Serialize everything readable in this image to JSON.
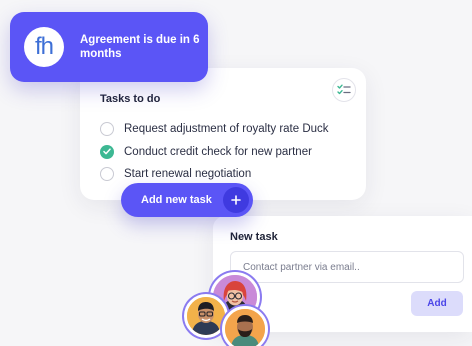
{
  "notification": {
    "logo_text": "fh",
    "message": "Agreement is due in 6 months",
    "color": "#5b55f6"
  },
  "tasks": {
    "title": "Tasks to do",
    "header_icon": "checklist-icon",
    "items": [
      {
        "label": "Request adjustment of royalty rate Duck",
        "done": false
      },
      {
        "label": "Conduct credit check for new partner",
        "done": true
      },
      {
        "label": "Start renewal negotiation",
        "done": false
      }
    ],
    "done_color": "#3db893"
  },
  "add_task_button": {
    "label": "Add new task",
    "icon": "plus-icon"
  },
  "new_task": {
    "title": "New task",
    "input_placeholder": "Contact partner via email..",
    "input_value": "",
    "add_label": "Add"
  },
  "avatars": [
    {
      "name": "avatar-woman-red-hair"
    },
    {
      "name": "avatar-man-glasses"
    },
    {
      "name": "avatar-man-beard"
    }
  ]
}
